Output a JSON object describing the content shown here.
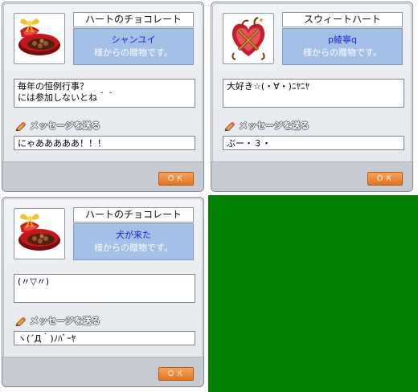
{
  "gifts": [
    {
      "item_name": "ハートのチョコレート",
      "sender": "シャンユイ",
      "from_text": "様からの贈物です。",
      "message": "毎年の恒例行事？\nには参加しないとね＾＾",
      "reply_label": "メッセージを送る",
      "reply_value": "にゃあああああ！！！",
      "ok_label": "ＯＫ",
      "icon": "heart-chocolate-box-icon"
    },
    {
      "item_name": "スウィートハート",
      "sender": "p綾寧q",
      "from_text": "様からの贈物です。",
      "message": "大好き☆(・∀・)ﾆﾔﾆﾔ",
      "reply_label": "メッセージを送る",
      "reply_value": "ぶー・３・",
      "ok_label": "ＯＫ",
      "icon": "sweet-heart-box-icon"
    },
    {
      "item_name": "ハートのチョコレート",
      "sender": "犬が来た",
      "from_text": "様からの贈物です。",
      "message": "(〃▽〃)",
      "reply_label": "メッセージを送る",
      "reply_value": "ヽ(´Д｀)ﾉﾊﾞｰﾔ",
      "ok_label": "ＯＫ",
      "icon": "heart-chocolate-box-icon"
    }
  ],
  "colors": {
    "sender_text": "#1b22d8",
    "info_background": "#a3c0e6",
    "ok_button": "#e4731c",
    "backdrop": "#028002"
  }
}
